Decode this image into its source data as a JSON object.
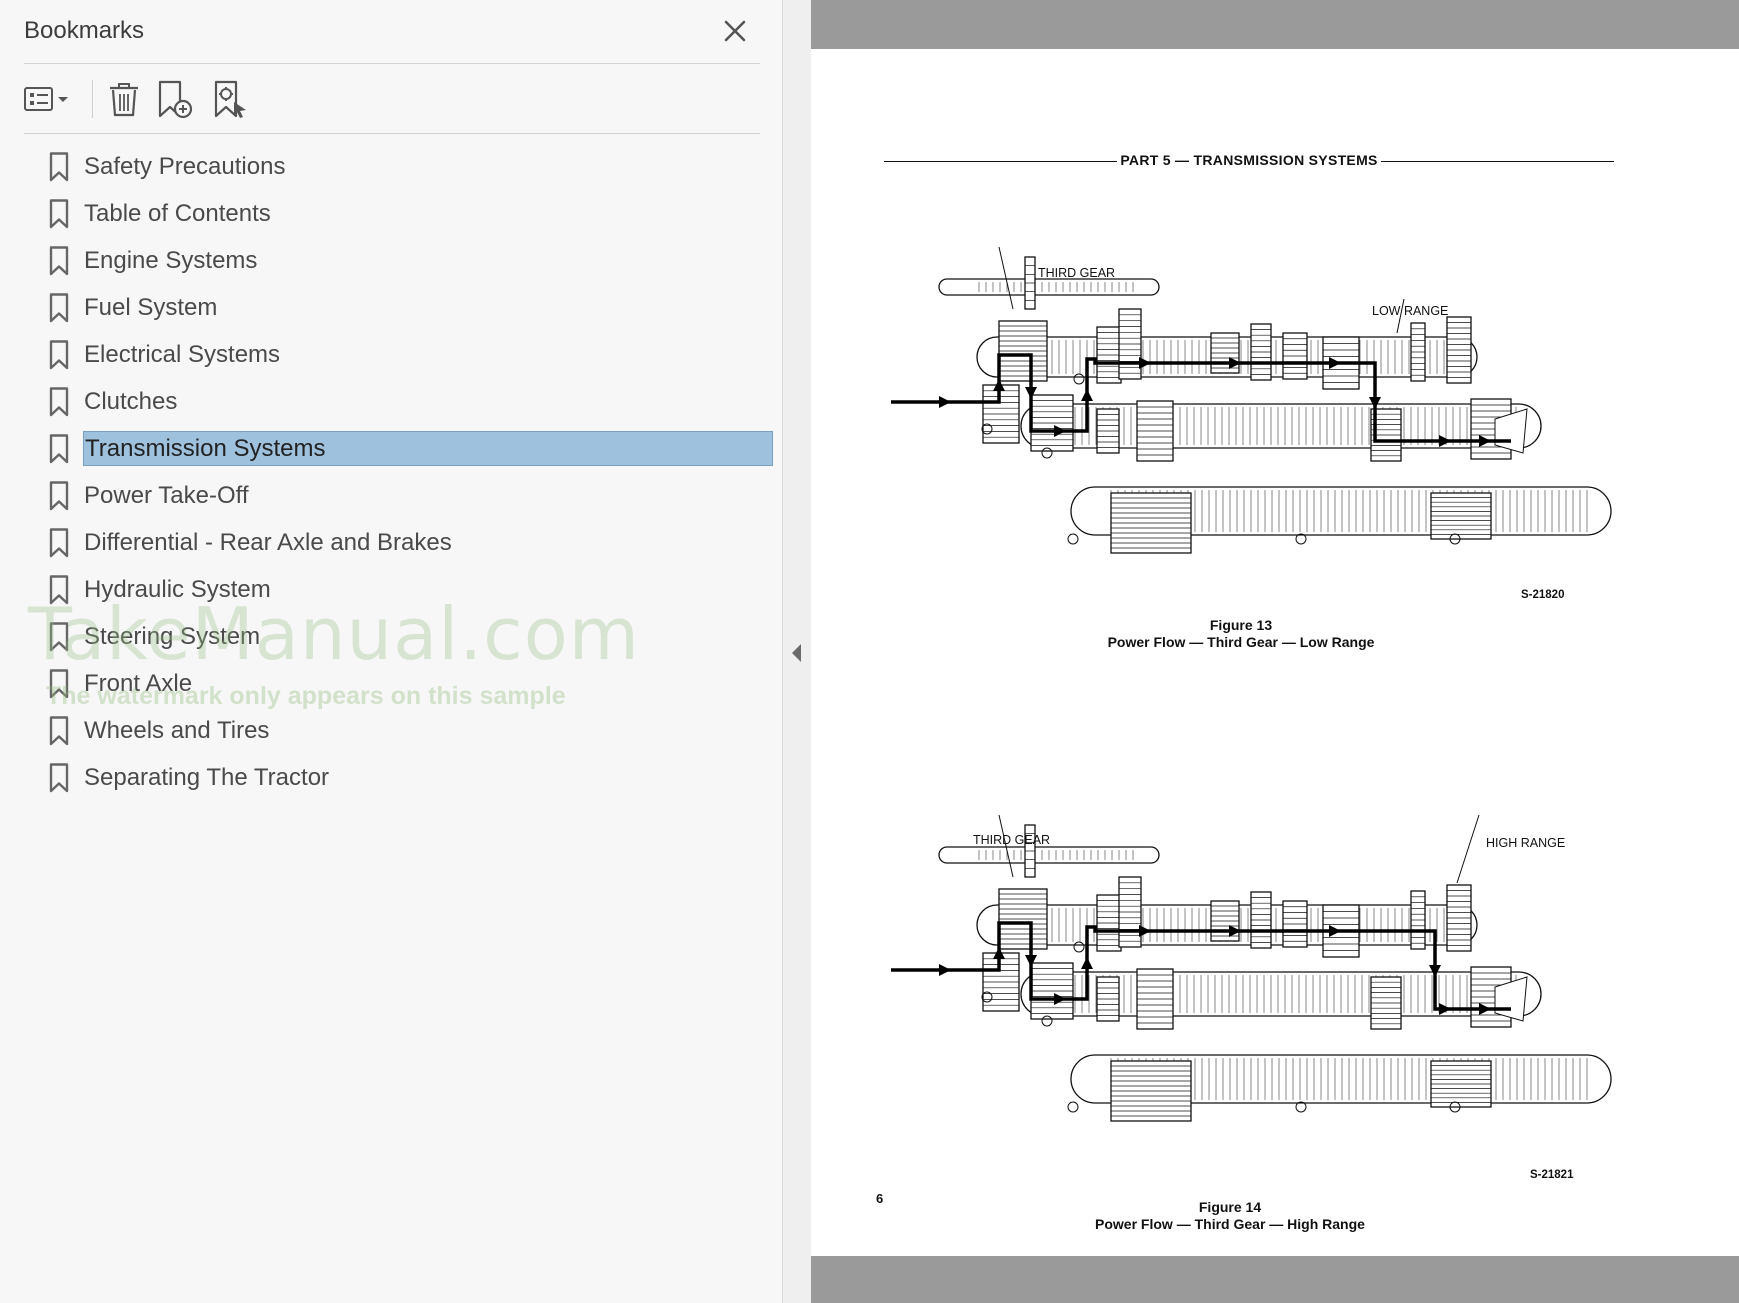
{
  "panel": {
    "title": "Bookmarks",
    "toolbar": {
      "options_icon": "list-options-icon",
      "delete_icon": "trash-icon",
      "add_icon": "add-bookmark-icon",
      "find_icon": "find-bookmark-icon"
    }
  },
  "bookmarks": [
    {
      "label": "Safety Precautions"
    },
    {
      "label": "Table of Contents"
    },
    {
      "label": "Engine Systems"
    },
    {
      "label": "Fuel System"
    },
    {
      "label": "Electrical Systems"
    },
    {
      "label": "Clutches"
    },
    {
      "label": "Transmission Systems",
      "selected": true
    },
    {
      "label": "Power Take-Off"
    },
    {
      "label": "Differential - Rear Axle and Brakes"
    },
    {
      "label": "Hydraulic System"
    },
    {
      "label": "Steering System"
    },
    {
      "label": "Front Axle"
    },
    {
      "label": "Wheels and Tires"
    },
    {
      "label": "Separating The Tractor"
    }
  ],
  "watermark": {
    "main": "TakeManual.com",
    "sub": "The watermark only appears on this sample"
  },
  "document": {
    "header": "PART 5 — TRANSMISSION SYSTEMS",
    "page_number": "6",
    "figures": [
      {
        "label_left": "THIRD GEAR",
        "label_right": "LOW RANGE",
        "code": "S-21820",
        "caption_title": "Figure 13",
        "caption_text": "Power Flow — Third Gear — Low Range"
      },
      {
        "label_left": "THIRD GEAR",
        "label_right": "HIGH RANGE",
        "code": "S-21821",
        "caption_title": "Figure 14",
        "caption_text": "Power Flow — Third Gear — High Range"
      }
    ]
  },
  "colors": {
    "selection": "#9ec1de",
    "viewer_bg": "#9a9a9a",
    "panel_bg": "#f7f7f7"
  }
}
